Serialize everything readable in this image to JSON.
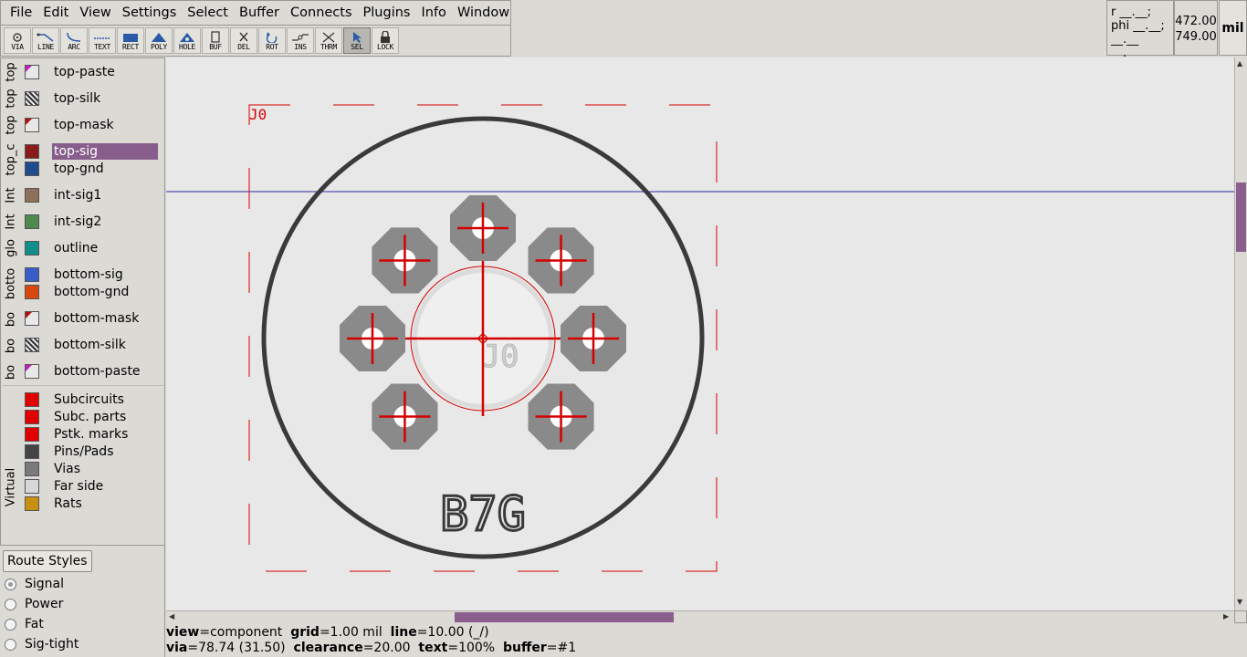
{
  "menubar": {
    "items": [
      "File",
      "Edit",
      "View",
      "Settings",
      "Select",
      "Buffer",
      "Connects",
      "Plugins",
      "Info",
      "Window"
    ]
  },
  "toolbar": {
    "tools": [
      {
        "label": "VIA",
        "icon": "via-icon"
      },
      {
        "label": "LINE",
        "icon": "line-icon"
      },
      {
        "label": "ARC",
        "icon": "arc-icon"
      },
      {
        "label": "TEXT",
        "icon": "text-icon"
      },
      {
        "label": "RECT",
        "icon": "rect-icon"
      },
      {
        "label": "POLY",
        "icon": "poly-icon"
      },
      {
        "label": "HOLE",
        "icon": "hole-icon"
      },
      {
        "label": "BUF",
        "icon": "buffer-icon"
      },
      {
        "label": "DEL",
        "icon": "delete-icon"
      },
      {
        "label": "ROT",
        "icon": "rotate-icon"
      },
      {
        "label": "INS",
        "icon": "insert-icon"
      },
      {
        "label": "THRM",
        "icon": "thermal-icon"
      },
      {
        "label": "SEL",
        "icon": "select-icon",
        "active": true
      },
      {
        "label": "LOCK",
        "icon": "lock-icon"
      }
    ]
  },
  "coords": {
    "r_line": "r __.__;",
    "phi_line": "phi __.__;",
    "under_line": "__.__ __.__",
    "x": "472.00",
    "y": "749.00",
    "unit": "mil"
  },
  "layers": {
    "groups": [
      "top",
      "top",
      "top",
      "top_c",
      "Int",
      "Int",
      "glo",
      "botto",
      "bo",
      "bo",
      "bo",
      "Virtual"
    ],
    "items": [
      {
        "name": "top-paste",
        "color": "#e8e8e8",
        "pattern": "paste"
      },
      {
        "name": "top-silk",
        "color": "#333333",
        "pattern": "hatch"
      },
      {
        "name": "top-mask",
        "color": "#e8e8e8",
        "pattern": "mask"
      },
      {
        "name": "top-sig",
        "color": "#8b1a1a",
        "selected": true
      },
      {
        "name": "top-gnd",
        "color": "#1e4c8c"
      },
      {
        "name": "int-sig1",
        "color": "#8c705a"
      },
      {
        "name": "int-sig2",
        "color": "#4e8a4e"
      },
      {
        "name": "outline",
        "color": "#138c8c"
      },
      {
        "name": "bottom-sig",
        "color": "#3a5cc8"
      },
      {
        "name": "bottom-gnd",
        "color": "#d8480c"
      },
      {
        "name": "bottom-mask",
        "color": "#e8e8e8",
        "pattern": "mask"
      },
      {
        "name": "bottom-silk",
        "color": "#333333",
        "pattern": "hatch"
      },
      {
        "name": "bottom-paste",
        "color": "#e8e8e8",
        "pattern": "paste"
      }
    ],
    "virtual": [
      {
        "name": "Subcircuits",
        "color": "#e00000"
      },
      {
        "name": "Subc. parts",
        "color": "#e00000"
      },
      {
        "name": "Pstk. marks",
        "color": "#e00000"
      },
      {
        "name": "Pins/Pads",
        "color": "#444444"
      },
      {
        "name": "Vias",
        "color": "#7a7a7a"
      },
      {
        "name": "Far side",
        "color": "#d8d8d8"
      },
      {
        "name": "Rats",
        "color": "#c89010"
      }
    ]
  },
  "route_styles": {
    "button": "Route Styles",
    "options": [
      {
        "label": "Signal",
        "checked": true
      },
      {
        "label": "Power",
        "checked": false
      },
      {
        "label": "Fat",
        "checked": false
      },
      {
        "label": "Sig-tight",
        "checked": false
      }
    ]
  },
  "canvas": {
    "refdes": "J0",
    "center_label": "J0",
    "footprint_name": "B7G",
    "colors": {
      "subc": "#d40000",
      "pad": "#8a8a8a",
      "silk": "#3a3a3a",
      "crosshair": "#2a2aa0",
      "background": "#e8e8e8"
    }
  },
  "status": {
    "view_key": "view",
    "view_val": "=component",
    "grid_key": "grid",
    "grid_val": "=1.00 mil",
    "line_key": "line",
    "line_val": "=10.00 (_/)",
    "via_key": "via",
    "via_val": "=78.74 (31.50)",
    "clearance_key": "clearance",
    "clearance_val": "=20.00",
    "text_key": "text",
    "text_val": "=100%",
    "buffer_key": "buffer",
    "buffer_val": "=#1"
  }
}
